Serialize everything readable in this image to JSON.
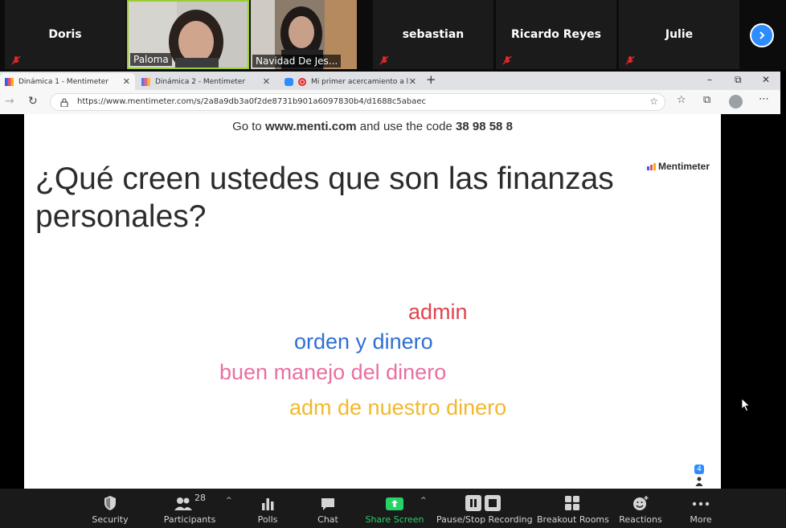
{
  "participants": {
    "tiles": [
      {
        "name": "Doris",
        "muted": true,
        "video": false
      },
      {
        "name": "Paloma",
        "muted": false,
        "video": true
      },
      {
        "name": "Navidad De Jes...",
        "muted": false,
        "video": true
      },
      {
        "name": "sebastian",
        "muted": true,
        "video": false
      },
      {
        "name": "Ricardo Reyes",
        "muted": true,
        "video": false
      },
      {
        "name": "Julie",
        "muted": true,
        "video": false
      }
    ],
    "next_icon": "chevron-right-icon"
  },
  "browser": {
    "tabs": [
      {
        "title": "Dinámica 1 - Mentimeter",
        "active": true
      },
      {
        "title": "Dinámica 2 - Mentimeter",
        "active": false
      },
      {
        "title": "Mi primer acercamiento a l",
        "active": false
      }
    ],
    "url": "https://www.mentimeter.com/s/2a8a9db3a0f2de8731b901a6097830b4/d1688c5abaec",
    "window_controls": [
      "–",
      "⧉",
      "✕"
    ],
    "new_tab_label": "+"
  },
  "slide": {
    "code_prefix": "Go to ",
    "code_site": "www.menti.com",
    "code_middle": " and use the code ",
    "code_value": "38 98 58 8",
    "question": "¿Qué creen ustedes que son las finanzas personales?",
    "brand": "Mentimeter",
    "voter_count": "4",
    "words": [
      {
        "text": "admin",
        "color": "#e0434f"
      },
      {
        "text": "orden y dinero",
        "color": "#2f6fd3"
      },
      {
        "text": "buen manejo del dinero",
        "color": "#ea6fa2"
      },
      {
        "text": "adm de nuestro dinero",
        "color": "#f2b82b"
      }
    ]
  },
  "toolbar": {
    "security": "Security",
    "participants": "Participants",
    "participants_count": "28",
    "polls": "Polls",
    "chat": "Chat",
    "share_screen": "Share Screen",
    "recording": "Pause/Stop Recording",
    "breakout": "Breakout Rooms",
    "reactions": "Reactions",
    "more": "More"
  },
  "colors": {
    "zoom_blue": "#2d8cff",
    "share_green": "#25d366",
    "mute_red": "#e02828"
  }
}
